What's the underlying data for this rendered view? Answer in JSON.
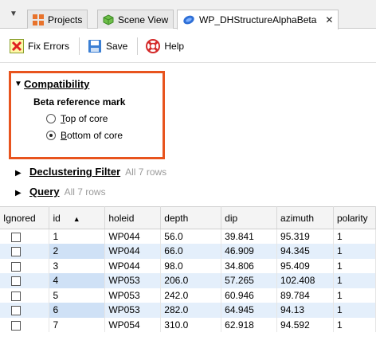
{
  "tabs": [
    {
      "label": "Projects",
      "icon": "projects-grid-icon"
    },
    {
      "label": "Scene View",
      "icon": "cube-icon"
    },
    {
      "label": "WP_DHStructureAlphaBeta",
      "icon": "structure-icon",
      "close": "✕"
    }
  ],
  "toolbar": {
    "fix_errors": "Fix Errors",
    "save": "Save",
    "help": "Help"
  },
  "compatibility": {
    "title": "Compatibility",
    "subtitle": "Beta reference mark",
    "options": [
      {
        "label": "Top of core",
        "selected": false
      },
      {
        "label": "Bottom of core",
        "selected": true
      }
    ]
  },
  "declustering": {
    "title": "Declustering Filter",
    "count": "All 7 rows"
  },
  "query": {
    "title": "Query",
    "count": "All 7 rows"
  },
  "table": {
    "columns": [
      "Ignored",
      "id",
      "holeid",
      "depth",
      "dip",
      "azimuth",
      "polarity"
    ],
    "rows": [
      {
        "id": "1",
        "holeid": "WP044",
        "depth": "56.0",
        "dip": "39.841",
        "azimuth": "95.319",
        "polarity": "1"
      },
      {
        "id": "2",
        "holeid": "WP044",
        "depth": "66.0",
        "dip": "46.909",
        "azimuth": "94.345",
        "polarity": "1"
      },
      {
        "id": "3",
        "holeid": "WP044",
        "depth": "98.0",
        "dip": "34.806",
        "azimuth": "95.409",
        "polarity": "1"
      },
      {
        "id": "4",
        "holeid": "WP053",
        "depth": "206.0",
        "dip": "57.265",
        "azimuth": "102.408",
        "polarity": "1"
      },
      {
        "id": "5",
        "holeid": "WP053",
        "depth": "242.0",
        "dip": "60.946",
        "azimuth": "89.784",
        "polarity": "1"
      },
      {
        "id": "6",
        "holeid": "WP053",
        "depth": "282.0",
        "dip": "64.945",
        "azimuth": "94.13",
        "polarity": "1"
      },
      {
        "id": "7",
        "holeid": "WP054",
        "depth": "310.0",
        "dip": "62.918",
        "azimuth": "94.592",
        "polarity": "1"
      }
    ]
  },
  "colors": {
    "highlight": "#e8541e",
    "row_alt": "#e4effb"
  }
}
